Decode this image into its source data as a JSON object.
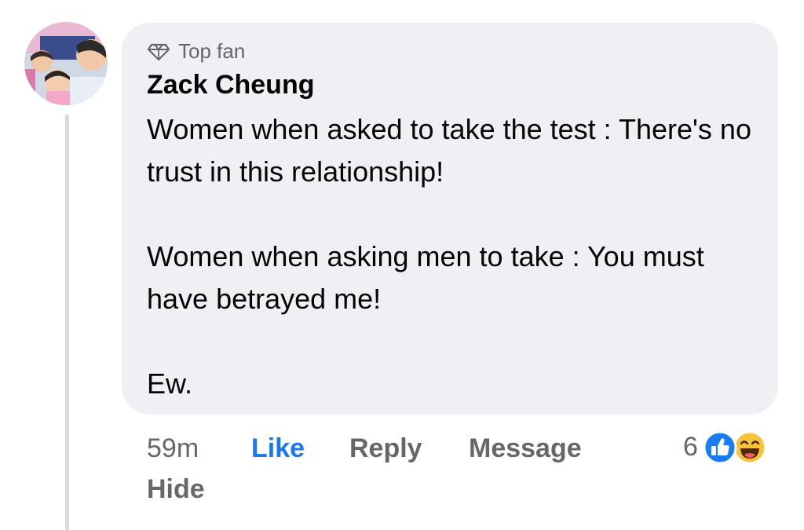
{
  "comment": {
    "badge": "Top fan",
    "badge_icon": "diamond-icon",
    "author": "Zack Cheung",
    "body_paragraphs": [
      "Women when asked to take the test : There's no trust in this relationship!",
      "Women when asking men to take : You must have betrayed me!",
      "Ew."
    ],
    "timestamp": "59m",
    "actions": {
      "like": "Like",
      "reply": "Reply",
      "message": "Message",
      "hide": "Hide"
    },
    "reactions": {
      "count": "6",
      "types": [
        "like-reaction-icon",
        "haha-reaction-icon"
      ]
    }
  },
  "colors": {
    "bubble": "#eff0f4",
    "like_blue": "#1877f2",
    "secondary_text": "#65676b",
    "primary_text": "#050505"
  }
}
